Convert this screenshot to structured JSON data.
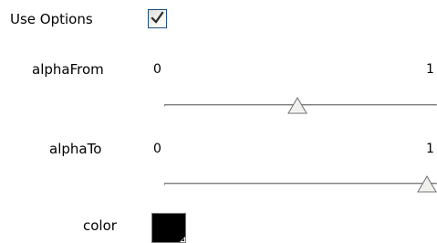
{
  "use_options": {
    "label": "Use Options",
    "checked": true
  },
  "alpha_from": {
    "label": "alphaFrom",
    "min_label": "0",
    "max_label": "1",
    "value": 0.5
  },
  "alpha_to": {
    "label": "alphaTo",
    "min_label": "0",
    "max_label": "1",
    "value": 1.0
  },
  "color": {
    "label": "color",
    "value": "#000000"
  },
  "colors": {
    "checkbox_border": "#1c5180",
    "checkmark": "#2a2a2a",
    "slider_track": "#c9c9c9",
    "slider_thumb_fill": "#f0f0ec",
    "slider_thumb_border": "#6e6e6e"
  },
  "icons": {
    "checkmark": "check-icon",
    "slider_thumb": "triangle-thumb-icon",
    "swatch_dropdown": "corner-arrow-icon"
  }
}
